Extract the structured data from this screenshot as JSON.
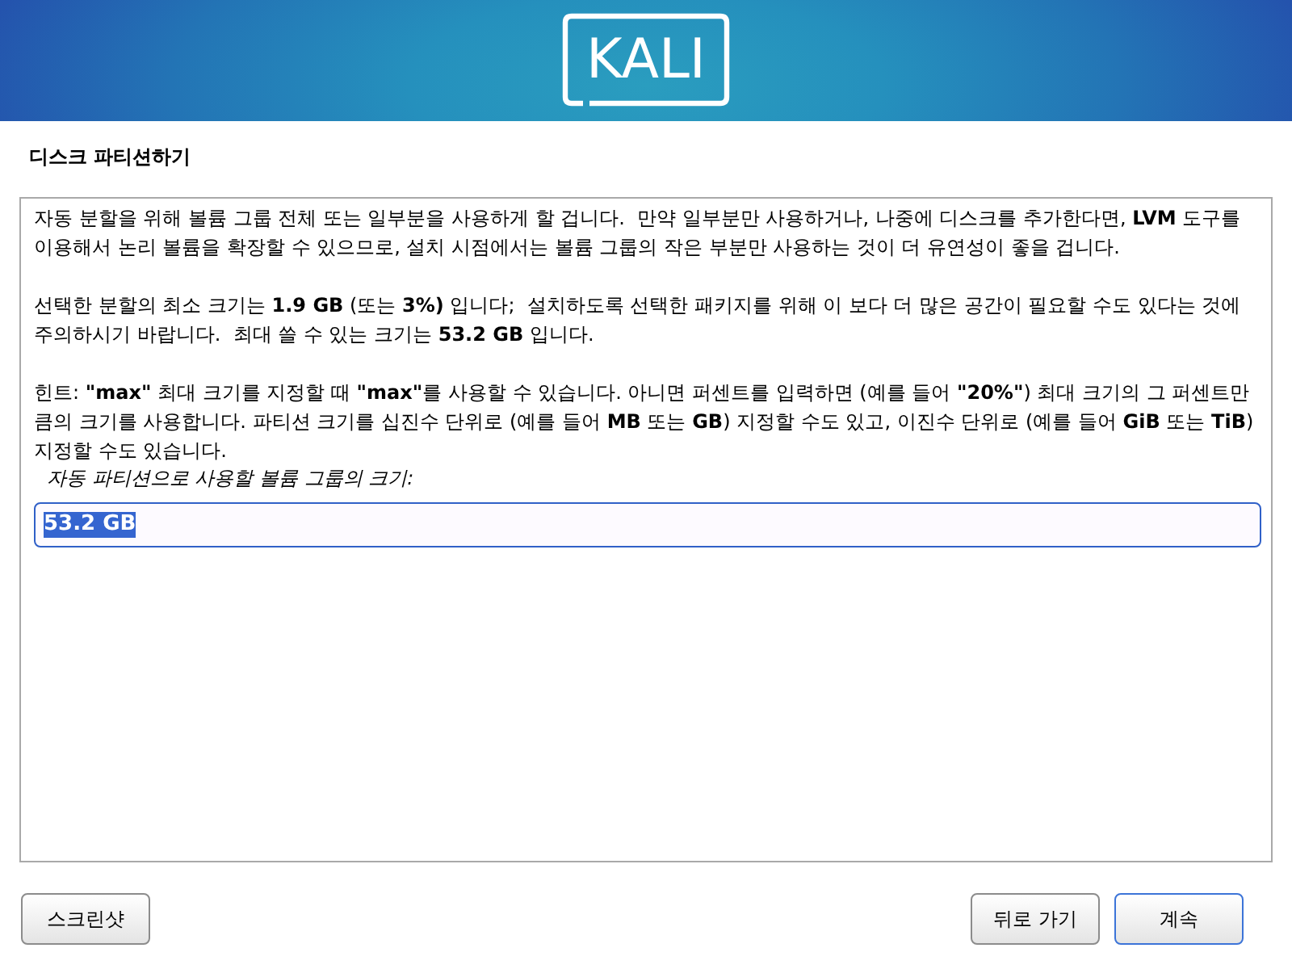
{
  "header": {
    "logo_text": "KALI"
  },
  "page_title": "디스크 파티션하기",
  "paragraphs": [
    "자동 분할을 위해 볼륨 그룹 전체 또는 일부분을 사용하게 할 겁니다.  만약 일부분만 사용하거나, 나중에 디스크를 추가한다면, **LVM** 도구를 이용해서 논리 볼륨을 확장할 수 있으므로, 설치 시점에서는 볼륨 그룹의 작은 부분만 사용하는 것이 더 유연성이 좋을 겁니다.",
    "선택한 분할의 최소 크기는 **1.9 GB** (또는 **3%)** 입니다;  설치하도록 선택한 패키지를 위해 이 보다 더 많은 공간이 필요할 수도 있다는 것에 주의하시기 바랍니다.  최대 쓸 수 있는 크기는 **53.2 GB** 입니다.",
    "힌트: **\"max\"** 최대 크기를 지정할 때 **\"max\"**를 사용할 수 있습니다. 아니면 퍼센트를 입력하면 (예를 들어 **\"20%\"**) 최대 크기의 그 퍼센트만큼의 크기를 사용합니다. 파티션 크기를 십진수 단위로 (예를 들어 **MB** 또는 **GB**) 지정할 수도 있고, 이진수 단위로 (예를 들어 **GiB** 또는 **TiB**) 지정할 수도 있습니다."
  ],
  "size_field": {
    "label": "자동 파티션으로 사용할 볼륨 그룹의 크기:",
    "value": "53.2 GB",
    "selected": true
  },
  "left_buttons": [
    {
      "label": "스크린샷",
      "default": false
    }
  ],
  "right_buttons": [
    {
      "label": "뒤로 가기",
      "default": false
    },
    {
      "label": "계속",
      "default": true
    }
  ]
}
